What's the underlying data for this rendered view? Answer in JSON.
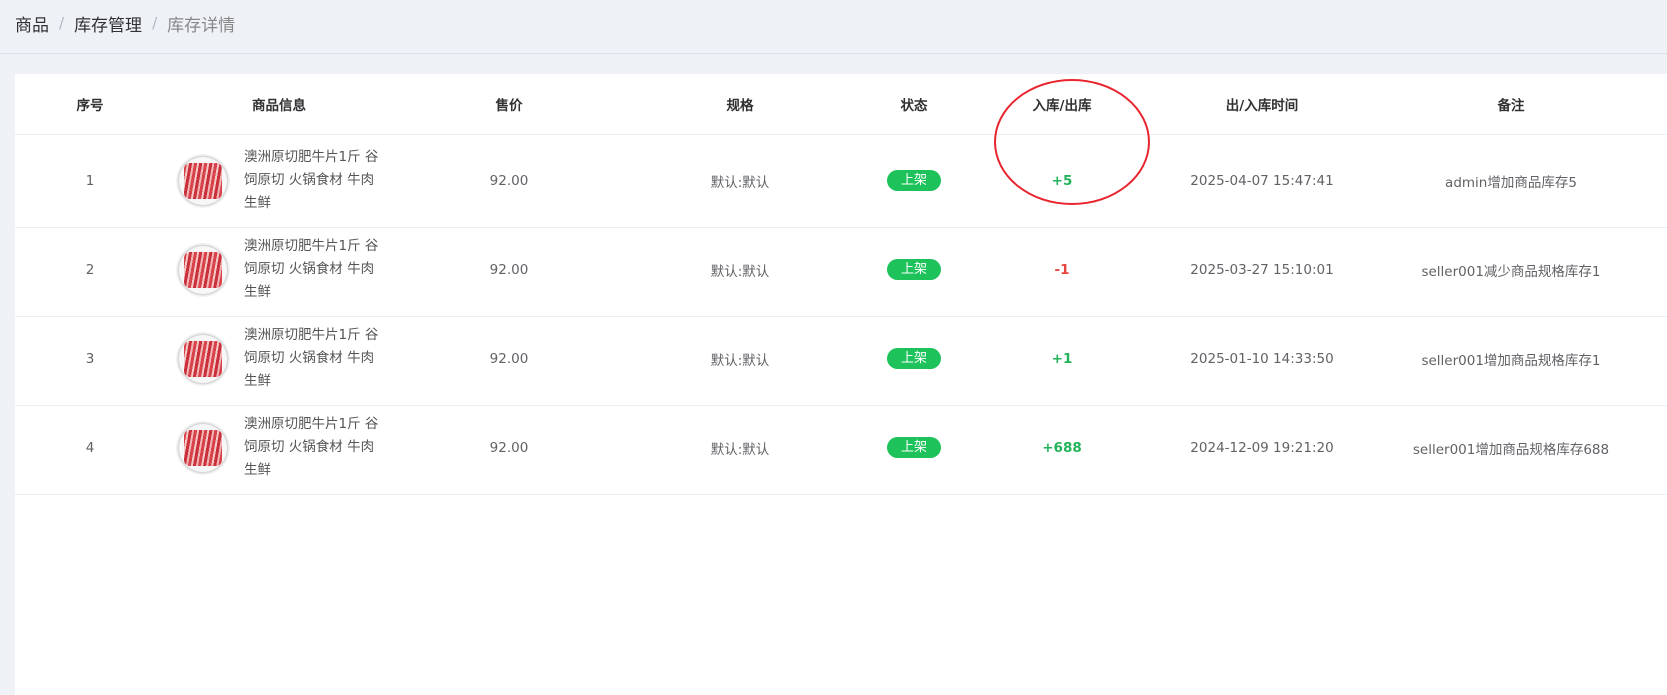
{
  "breadcrumb": [
    "商品",
    "库存管理",
    "库存详情"
  ],
  "table": {
    "headers": {
      "index": "序号",
      "info": "商品信息",
      "price": "售价",
      "spec": "规格",
      "status": "状态",
      "inout": "入库/出库",
      "time": "出/入库时间",
      "note": "备注"
    },
    "rows": [
      {
        "index": "1",
        "title": "澳洲原切肥牛片1斤 谷饲原切 火锅食材 牛肉生鲜",
        "price": "92.00",
        "spec": "默认:默认",
        "status": "上架",
        "change": "+5",
        "time": "2025-04-07 15:47:41",
        "note": "admin增加商品库存5"
      },
      {
        "index": "2",
        "title": "澳洲原切肥牛片1斤 谷饲原切 火锅食材 牛肉生鲜",
        "price": "92.00",
        "spec": "默认:默认",
        "status": "上架",
        "change": "-1",
        "time": "2025-03-27 15:10:01",
        "note": "seller001减少商品规格库存1"
      },
      {
        "index": "3",
        "title": "澳洲原切肥牛片1斤 谷饲原切 火锅食材 牛肉生鲜",
        "price": "92.00",
        "spec": "默认:默认",
        "status": "上架",
        "change": "+1",
        "time": "2025-01-10 14:33:50",
        "note": "seller001增加商品规格库存1"
      },
      {
        "index": "4",
        "title": "澳洲原切肥牛片1斤 谷饲原切 火锅食材 牛肉生鲜",
        "price": "92.00",
        "spec": "默认:默认",
        "status": "上架",
        "change": "+688",
        "time": "2024-12-09 19:21:20",
        "note": "seller001增加商品规格库存688"
      }
    ]
  },
  "colors": {
    "status_badge": "#1ec25a",
    "increase": "#22b35a",
    "decrease": "#e5453d",
    "annotation_circle": "#e8242e"
  },
  "icons": {
    "thumbnail": "beef-slices-product-image"
  }
}
